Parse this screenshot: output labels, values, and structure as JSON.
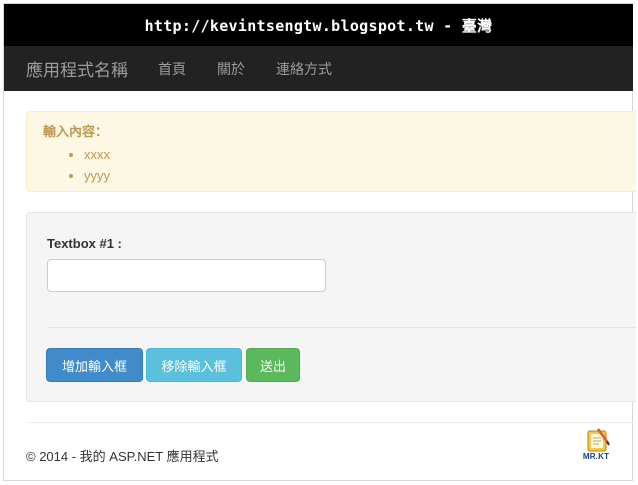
{
  "banner": {
    "url_text": "http://kevintsengtw.blogspot.tw - 臺灣"
  },
  "navbar": {
    "brand": "應用程式名稱",
    "links": [
      {
        "label": "首頁"
      },
      {
        "label": "關於"
      },
      {
        "label": "連絡方式"
      }
    ]
  },
  "alert": {
    "title": "輸入內容：",
    "items": [
      "xxxx",
      "yyyy"
    ]
  },
  "form": {
    "textbox_label": "Textbox #1 :",
    "textbox_value": "",
    "buttons": {
      "add_label": "增加輸入框",
      "remove_label": "移除輸入框",
      "submit_label": "送出"
    }
  },
  "footer": {
    "copyright": "© 2014 - 我的 ASP.NET 應用程式"
  },
  "logo": {
    "text": "MR.KT"
  },
  "colors": {
    "navbar_bg": "#222222",
    "alert_bg": "#fcf8e3",
    "alert_text": "#c09853",
    "btn_primary": "#428bca",
    "btn_info": "#5bc0de",
    "btn_success": "#5cb85c"
  }
}
